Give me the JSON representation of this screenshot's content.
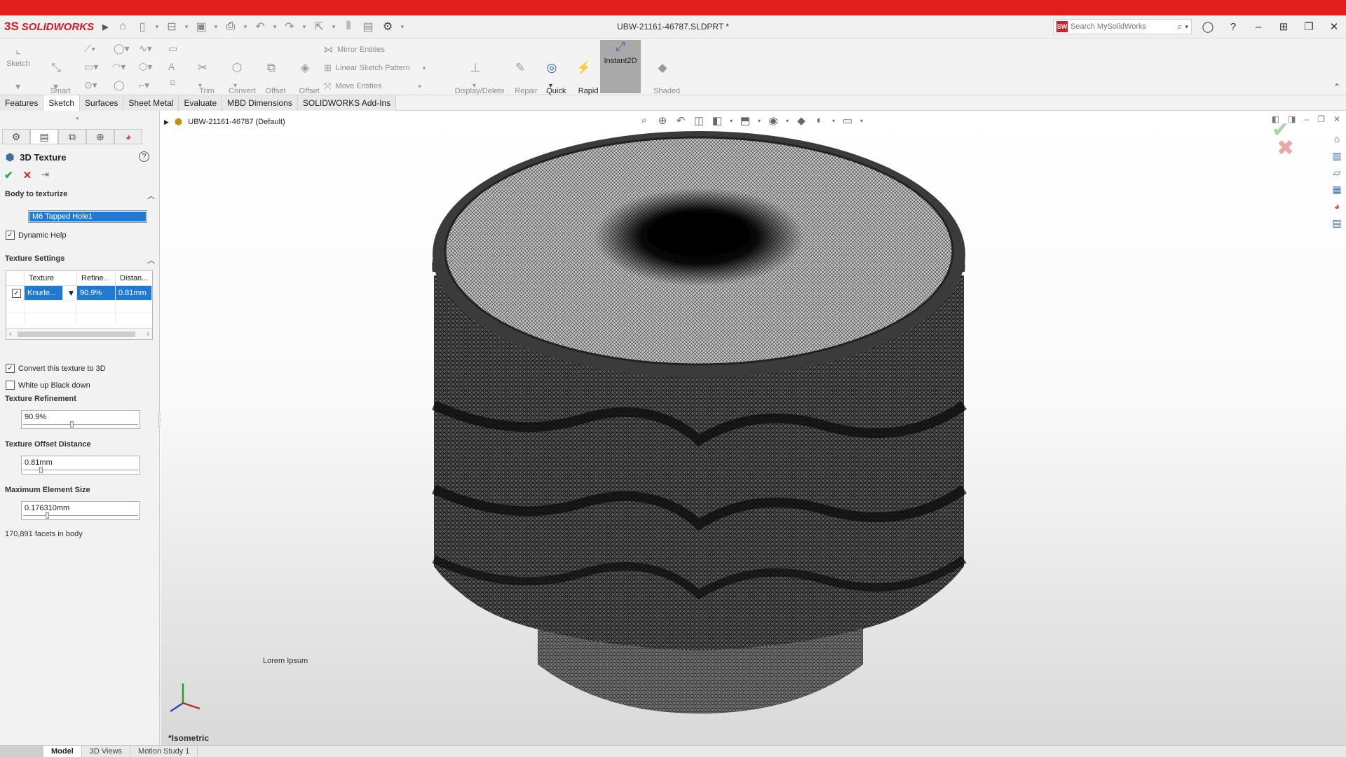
{
  "app": {
    "name": "SOLIDWORKS",
    "document_title": "UBW-21161-46787.SLDPRT *"
  },
  "search": {
    "placeholder": "Search MySolidWorks"
  },
  "ribbon": {
    "sketch": "Sketch",
    "smart_dimension": "Smart\nDimension",
    "trim_entities": "Trim\nEntities",
    "convert_entities": "Convert\nEntities",
    "offset_entities": "Offset\nEntities",
    "offset_on_surface": "Offset\nOn\nSurface",
    "mirror_entities": "Mirror Entities",
    "linear_sketch_pattern": "Linear Sketch Pattern",
    "move_entities": "Move Entities",
    "display_delete_relations": "Display/Delete\nRelations",
    "repair_sketch": "Repair\nSketch",
    "quick_snaps": "Quick\nSnaps",
    "rapid_sketch": "Rapid\nSketch",
    "instant2d": "Instant2D",
    "shaded_sketch_contours": "Shaded\nSketch\nContours"
  },
  "command_tabs": [
    "Features",
    "Sketch",
    "Surfaces",
    "Sheet Metal",
    "Evaluate",
    "MBD Dimensions",
    "SOLIDWORKS Add-Ins"
  ],
  "property_manager": {
    "title": "3D Texture",
    "body_group": "Body to texturize",
    "body_value": "M6 Tapped Hole1",
    "dynamic_help": "Dynamic Help",
    "texture_group": "Texture Settings",
    "table_headers": [
      "Texture",
      "Refine...",
      "Distan..."
    ],
    "table_row": {
      "texture": "Knurle...",
      "refinement": "90.9%",
      "distance": "0.81mm"
    },
    "convert_3d": "Convert this texture to 3D",
    "white_up": "White up Black down",
    "refinement_label": "Texture Refinement",
    "refinement_value": "90.9%",
    "offset_label": "Texture Offset Distance",
    "offset_value": "0.81mm",
    "max_element_label": "Maximum Element Size",
    "max_element_value": "0.176310mm",
    "facets": "170,891 facets in body"
  },
  "viewport": {
    "tree_label": "UBW-21161-46787 (Default)",
    "lorem": "Lorem Ipsum",
    "view_name": "*Isometric"
  },
  "bottom_tabs": [
    "Model",
    "3D Views",
    "Motion Study 1"
  ],
  "colors": {
    "brand_red": "#e31c1c",
    "selection_blue": "#1f7ad4",
    "ok_green": "#27a93b",
    "cancel_red": "#d02b2b"
  }
}
